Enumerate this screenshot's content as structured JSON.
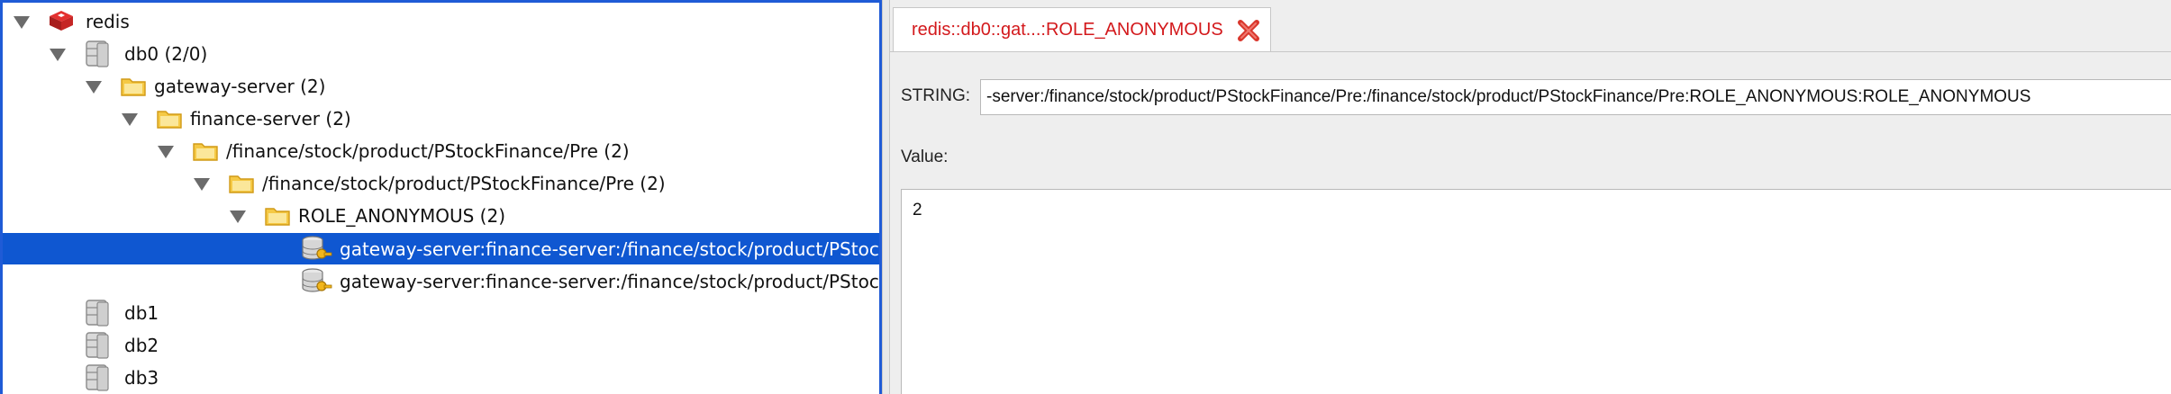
{
  "tree": {
    "root": {
      "label": "redis",
      "icon": "redis-logo-icon"
    },
    "db0": {
      "label": "db0 (2/0)",
      "icon": "database-icon"
    },
    "gateway": {
      "label": "gateway-server (2)",
      "icon": "folder-icon"
    },
    "finance": {
      "label": "finance-server (2)",
      "icon": "folder-icon"
    },
    "path1": {
      "label": "/finance/stock/product/PStockFinance/Pre (2)",
      "icon": "folder-icon"
    },
    "path2": {
      "label": "/finance/stock/product/PStockFinance/Pre (2)",
      "icon": "folder-icon"
    },
    "role": {
      "label": "ROLE_ANONYMOUS (2)",
      "icon": "folder-icon"
    },
    "key1": {
      "label": "gateway-server:finance-server:/finance/stock/product/PStockFinance/Pre:/finance/stock/product/PStockFinance/Pre:ROLE_ANONYMOUS:ROLE_ANONYMOUS",
      "icon": "key-icon"
    },
    "key2": {
      "label": "gateway-server:finance-server:/finance/stock/product/PStockFinance/Pre:/finance/stock/product/PStockFinance/Pre:ROLE_ANONYMOUS",
      "icon": "key-icon"
    },
    "db1": {
      "label": "db1",
      "icon": "database-icon"
    },
    "db2": {
      "label": "db2",
      "icon": "database-icon"
    },
    "db3": {
      "label": "db3",
      "icon": "database-icon"
    }
  },
  "tab": {
    "title": "redis::db0::gat...:ROLE_ANONYMOUS",
    "close_icon": "close-icon"
  },
  "editor": {
    "type_label": "STRING:",
    "key_value": "-server:/finance/stock/product/PStockFinance/Pre:/finance/stock/product/PStockFinance/Pre:ROLE_ANONYMOUS:ROLE_ANONYMOUS",
    "value_label": "Value:",
    "value": "2"
  },
  "colors": {
    "selection": "#0f57d1",
    "tab_text": "#d3191c",
    "close": "#d9362c"
  }
}
